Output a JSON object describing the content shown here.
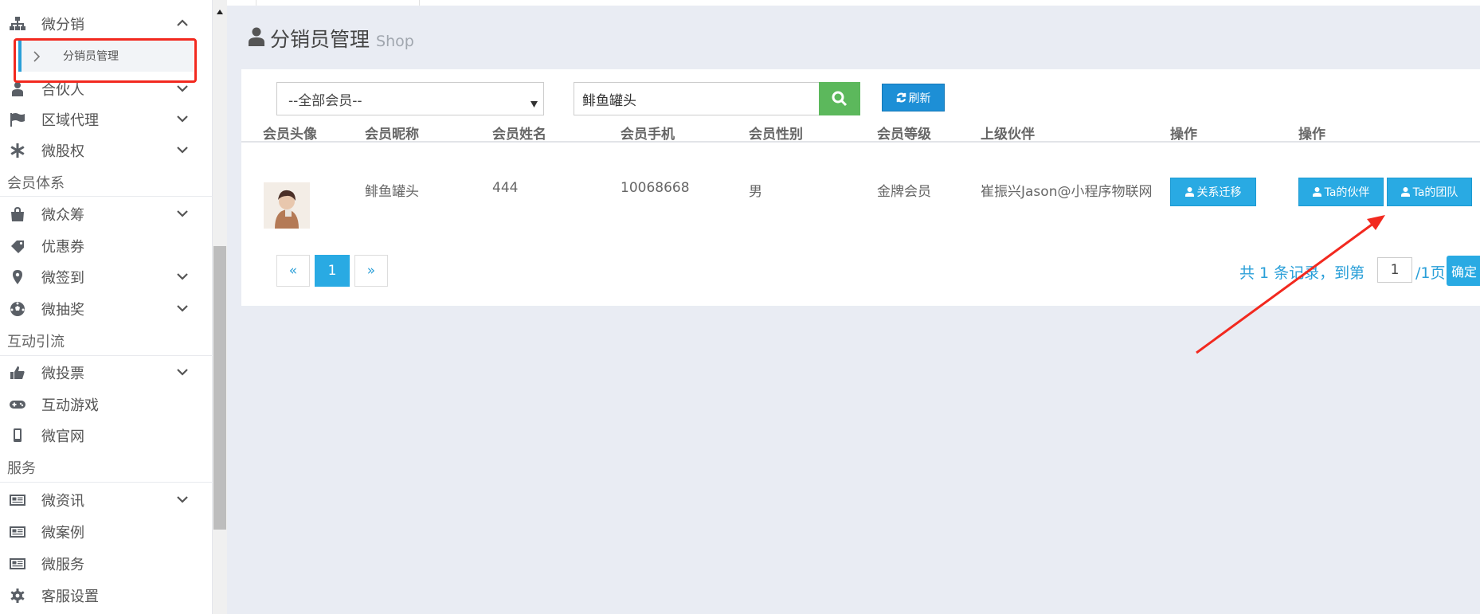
{
  "sidebar": {
    "distribution": {
      "label": "微分销",
      "sub_label": "分销员管理"
    },
    "partner": "合伙人",
    "regional": "区域代理",
    "equity": "微股权",
    "section_member": "会员体系",
    "crowdfund": "微众筹",
    "coupon": "优惠券",
    "signin": "微签到",
    "lottery": "微抽奖",
    "section_interact": "互动引流",
    "vote": "微投票",
    "game": "互动游戏",
    "site": "微官网",
    "section_service": "服务",
    "news": "微资讯",
    "cases": "微案例",
    "services": "微服务",
    "cs": "客服设置"
  },
  "header": {
    "title": "分销员管理",
    "subtitle": "Shop"
  },
  "filters": {
    "member_select": "--全部会员--",
    "search_value": "鲱鱼罐头",
    "refresh_label": "刷新"
  },
  "table": {
    "headers": [
      "会员头像",
      "会员昵称",
      "会员姓名",
      "会员手机",
      "会员性别",
      "会员等级",
      "上级伙伴",
      "操作",
      "操作"
    ],
    "row": {
      "nickname": "鲱鱼罐头",
      "name": "444",
      "phone": "10068668",
      "gender": "男",
      "level": "金牌会员",
      "upper": "崔振兴Jason@小程序物联网",
      "btn_transfer": "关系迁移",
      "btn_partner": "Ta的伙伴",
      "btn_team": "Ta的团队"
    }
  },
  "pagination": {
    "prev": "«",
    "current": "1",
    "next": "»",
    "info": "共 1 条记录，到第",
    "page_input": "1",
    "total_pages": "/1页",
    "confirm": "确定"
  },
  "colors": {
    "accent": "#29aae3",
    "search_green": "#5cb85c",
    "annotation_red": "#f2291f"
  }
}
